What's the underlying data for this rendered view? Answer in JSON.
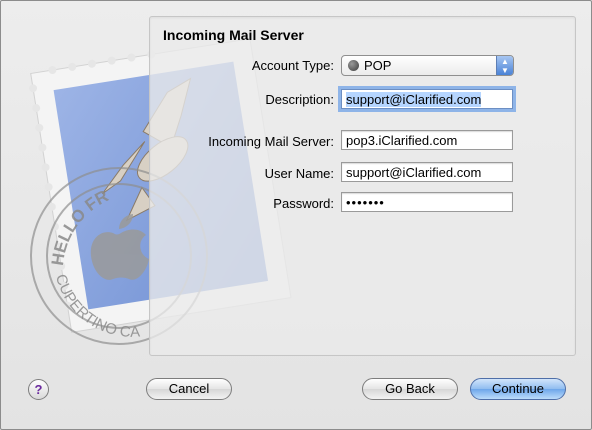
{
  "form": {
    "title": "Incoming Mail Server",
    "account_type_label": "Account Type:",
    "account_type_value": "POP",
    "description_label": "Description:",
    "description_value": "support@iClarified.com",
    "incoming_server_label": "Incoming Mail Server:",
    "incoming_server_value": "pop3.iClarified.com",
    "user_name_label": "User Name:",
    "user_name_value": "support@iClarified.com",
    "password_label": "Password:",
    "password_value": "•••••••"
  },
  "artwork": {
    "stamp_top_text": "HELLO FR",
    "stamp_bottom_text": "CUPERTINO CA"
  },
  "buttons": {
    "help": "?",
    "cancel": "Cancel",
    "go_back": "Go Back",
    "continue": "Continue"
  }
}
